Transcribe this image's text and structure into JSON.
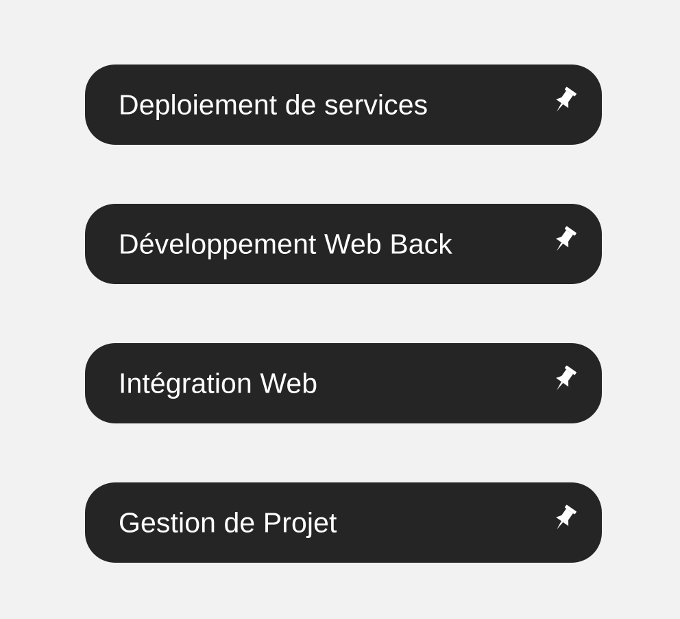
{
  "colors": {
    "background": "#f2f2f2",
    "pill": "#252525",
    "text": "#ffffff"
  },
  "items": [
    {
      "label": "Deploiement de services",
      "icon": "pin-icon"
    },
    {
      "label": "Développement Web Back",
      "icon": "pin-icon"
    },
    {
      "label": "Intégration Web",
      "icon": "pin-icon"
    },
    {
      "label": "Gestion de Projet",
      "icon": "pin-icon"
    }
  ]
}
